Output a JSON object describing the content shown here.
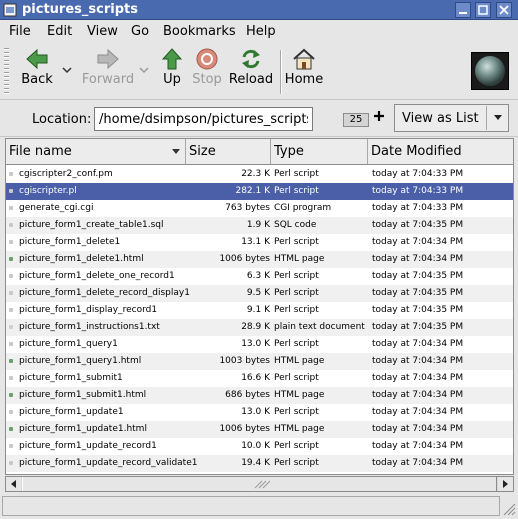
{
  "window": {
    "title": "pictures_scripts"
  },
  "menubar": {
    "items": [
      {
        "label": "File"
      },
      {
        "label": "Edit"
      },
      {
        "label": "View"
      },
      {
        "label": "Go"
      },
      {
        "label": "Bookmarks"
      },
      {
        "label": "Help"
      }
    ]
  },
  "toolbar": {
    "back_label": "Back",
    "forward_label": "Forward",
    "up_label": "Up",
    "stop_label": "Stop",
    "reload_label": "Reload",
    "home_label": "Home"
  },
  "location": {
    "label": "Location:",
    "value": "/home/dsimpson/pictures_scripts",
    "zoom": "25",
    "view_as": "View as List"
  },
  "list": {
    "columns": {
      "name": "File name",
      "size": "Size",
      "type": "Type",
      "date": "Date Modified"
    },
    "rows": [
      {
        "name": "cgiscripter2_conf.pm",
        "size": "22.3 K",
        "type": "Perl script",
        "date": "today at 7:04:33 PM"
      },
      {
        "name": "cgiscripter.pl",
        "size": "282.1 K",
        "type": "Perl script",
        "date": "today at 7:04:33 PM"
      },
      {
        "name": "generate_cgi.cgi",
        "size": "763 bytes",
        "type": "CGI program",
        "date": "today at 7:04:33 PM"
      },
      {
        "name": "picture_form1_create_table1.sql",
        "size": "1.9 K",
        "type": "SQL code",
        "date": "today at 7:04:35 PM"
      },
      {
        "name": "picture_form1_delete1",
        "size": "13.1 K",
        "type": "Perl script",
        "date": "today at 7:04:34 PM"
      },
      {
        "name": "picture_form1_delete1.html",
        "size": "1006 bytes",
        "type": "HTML page",
        "date": "today at 7:04:34 PM"
      },
      {
        "name": "picture_form1_delete_one_record1",
        "size": "6.3 K",
        "type": "Perl script",
        "date": "today at 7:04:35 PM"
      },
      {
        "name": "picture_form1_delete_record_display1",
        "size": "9.5 K",
        "type": "Perl script",
        "date": "today at 7:04:35 PM"
      },
      {
        "name": "picture_form1_display_record1",
        "size": "9.1 K",
        "type": "Perl script",
        "date": "today at 7:04:35 PM"
      },
      {
        "name": "picture_form1_instructions1.txt",
        "size": "28.9 K",
        "type": "plain text document",
        "date": "today at 7:04:35 PM"
      },
      {
        "name": "picture_form1_query1",
        "size": "13.0 K",
        "type": "Perl script",
        "date": "today at 7:04:34 PM"
      },
      {
        "name": "picture_form1_query1.html",
        "size": "1003 bytes",
        "type": "HTML page",
        "date": "today at 7:04:34 PM"
      },
      {
        "name": "picture_form1_submit1",
        "size": "16.6 K",
        "type": "Perl script",
        "date": "today at 7:04:34 PM"
      },
      {
        "name": "picture_form1_submit1.html",
        "size": "686 bytes",
        "type": "HTML page",
        "date": "today at 7:04:34 PM"
      },
      {
        "name": "picture_form1_update1",
        "size": "13.0 K",
        "type": "Perl script",
        "date": "today at 7:04:34 PM"
      },
      {
        "name": "picture_form1_update1.html",
        "size": "1006 bytes",
        "type": "HTML page",
        "date": "today at 7:04:34 PM"
      },
      {
        "name": "picture_form1_update_record1",
        "size": "10.0 K",
        "type": "Perl script",
        "date": "today at 7:04:34 PM"
      },
      {
        "name": "picture_form1_update_record_validate1",
        "size": "19.4 K",
        "type": "Perl script",
        "date": "today at 7:04:34 PM"
      }
    ],
    "selected_row": "cgiscripter.pl"
  },
  "colors": {
    "titlebar": "#4a6ab0",
    "selection": "#4a5fa8",
    "back_arrow": "#3a8a3a",
    "stop_red": "#c86060"
  }
}
